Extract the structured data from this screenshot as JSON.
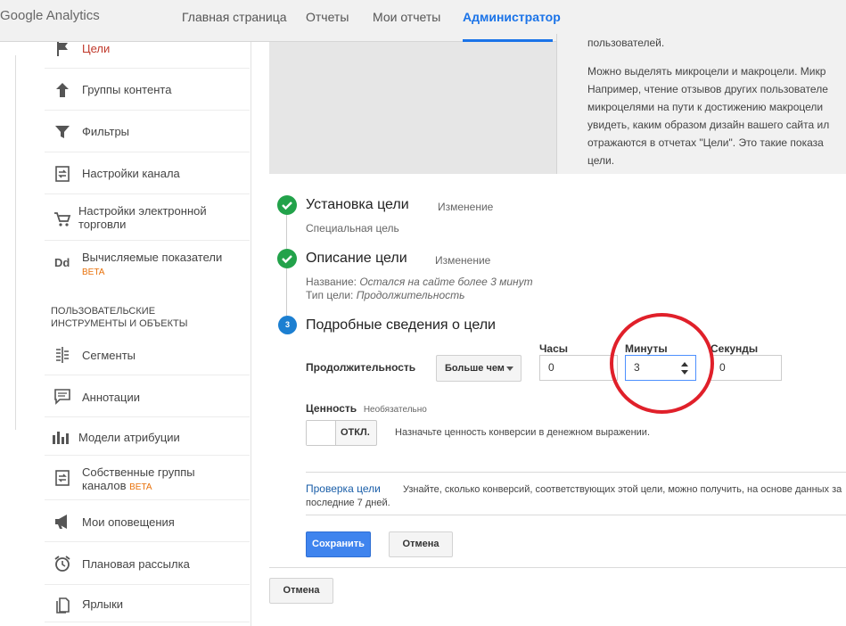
{
  "header": {
    "logo_google": "Google",
    "logo_analytics": "Analytics",
    "nav": [
      "Главная страница",
      "Отчеты",
      "Мои отчеты",
      "Администратор"
    ]
  },
  "sidebar": {
    "items": [
      {
        "label": "Цели",
        "icon": "flag-icon"
      },
      {
        "label": "Группы контента",
        "icon": "content-groups-icon"
      },
      {
        "label": "Фильтры",
        "icon": "filter-icon"
      },
      {
        "label": "Настройки канала",
        "icon": "channel-settings-icon"
      },
      {
        "label": "Настройки электронной",
        "label2": "торговли",
        "icon": "cart-icon"
      },
      {
        "label": "Вычисляемые показатели",
        "badge": "BETA",
        "icon": "dd-icon"
      }
    ],
    "section_title_1": "ПОЛЬЗОВАТЕЛЬСКИЕ",
    "section_title_2": "ИНСТРУМЕНТЫ И ОБЪЕКТЫ",
    "tools": [
      {
        "label": "Сегменты",
        "icon": "segments-icon"
      },
      {
        "label": "Аннотации",
        "icon": "annotations-icon"
      },
      {
        "label": "Модели атрибуции",
        "icon": "attribution-icon"
      },
      {
        "label": "Собственные группы",
        "label2": "каналов",
        "badge": "BETA",
        "icon": "channel-groups-icon"
      },
      {
        "label": "Мои оповещения",
        "icon": "megaphone-icon"
      },
      {
        "label": "Плановая рассылка",
        "icon": "alarm-icon"
      },
      {
        "label": "Ярлыки",
        "icon": "shortcuts-icon"
      }
    ]
  },
  "info": {
    "lines": [
      "пользователей.",
      "Можно выделять микроцели и макроцели. Микр",
      "Например, чтение отзывов других пользователе",
      "микроцелями на пути к достижению макроцели",
      "увидеть, каким образом дизайн вашего сайта ил",
      "отражаются в отчетах \"Цели\". Это такие показа",
      "цели."
    ]
  },
  "steps": {
    "step1": {
      "title": "Установка цели",
      "edit": "Изменение",
      "sub": "Специальная цель"
    },
    "step2": {
      "title": "Описание цели",
      "edit": "Изменение",
      "name_label": "Название:",
      "name_value": "Остался на сайте более 3 минут",
      "type_label": "Тип цели:",
      "type_value": "Продолжительность"
    },
    "step3": {
      "number": "3",
      "title": "Подробные сведения о цели"
    }
  },
  "form": {
    "duration_label": "Продолжительность",
    "comparison": "Больше чем",
    "hours_label": "Часы",
    "hours_value": "0",
    "minutes_label": "Минуты",
    "minutes_value": "3",
    "seconds_label": "Секунды",
    "seconds_value": "0",
    "value_label": "Ценность",
    "optional": "Необязательно",
    "toggle_label": "ОТКЛ.",
    "value_hint": "Назначьте ценность конверсии в денежном выражении.",
    "verify_link": "Проверка цели",
    "verify_text": "Узнайте, сколько конверсий, соответствующих этой цели, можно получить, на основе данных за",
    "verify_text2": "последние 7 дней.",
    "save": "Сохранить",
    "cancel": "Отмена"
  },
  "footer": {
    "cancel": "Отмена"
  },
  "colors": {
    "accent": "#1a73e8",
    "success": "#22a24a",
    "step_active": "#1c7fd1",
    "annotation": "#e0202a",
    "primary_button": "#3f84ee"
  }
}
